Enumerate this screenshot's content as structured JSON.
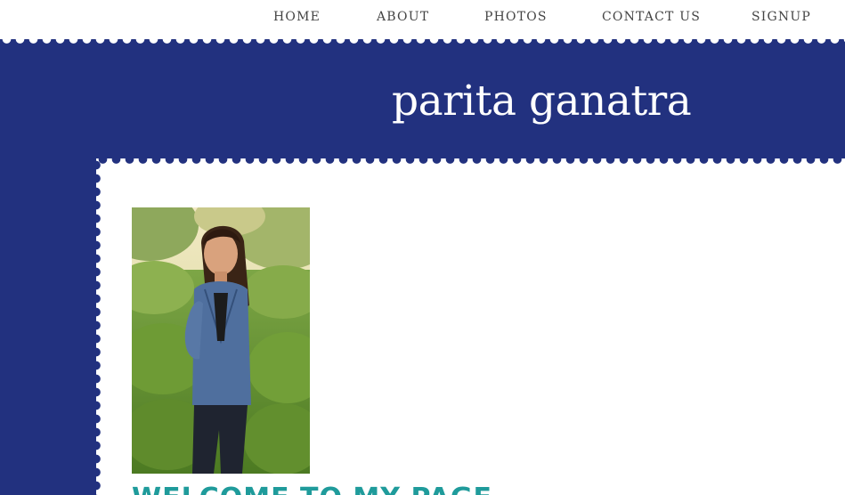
{
  "nav": {
    "items": [
      {
        "label": "HOME"
      },
      {
        "label": "ABOUT"
      },
      {
        "label": "PHOTOS"
      },
      {
        "label": "CONTACT US"
      },
      {
        "label": "SIGNUP"
      }
    ]
  },
  "header": {
    "site_title": "parita ganatra"
  },
  "main": {
    "photo_alt": "Portrait photo of a woman in a denim jacket",
    "heading": "WELCOME TO MY PAGE"
  },
  "colors": {
    "brand_blue": "#22317f",
    "page_white": "#ffffff",
    "nav_text": "#444444",
    "heading_teal": "#1f9b9b"
  }
}
